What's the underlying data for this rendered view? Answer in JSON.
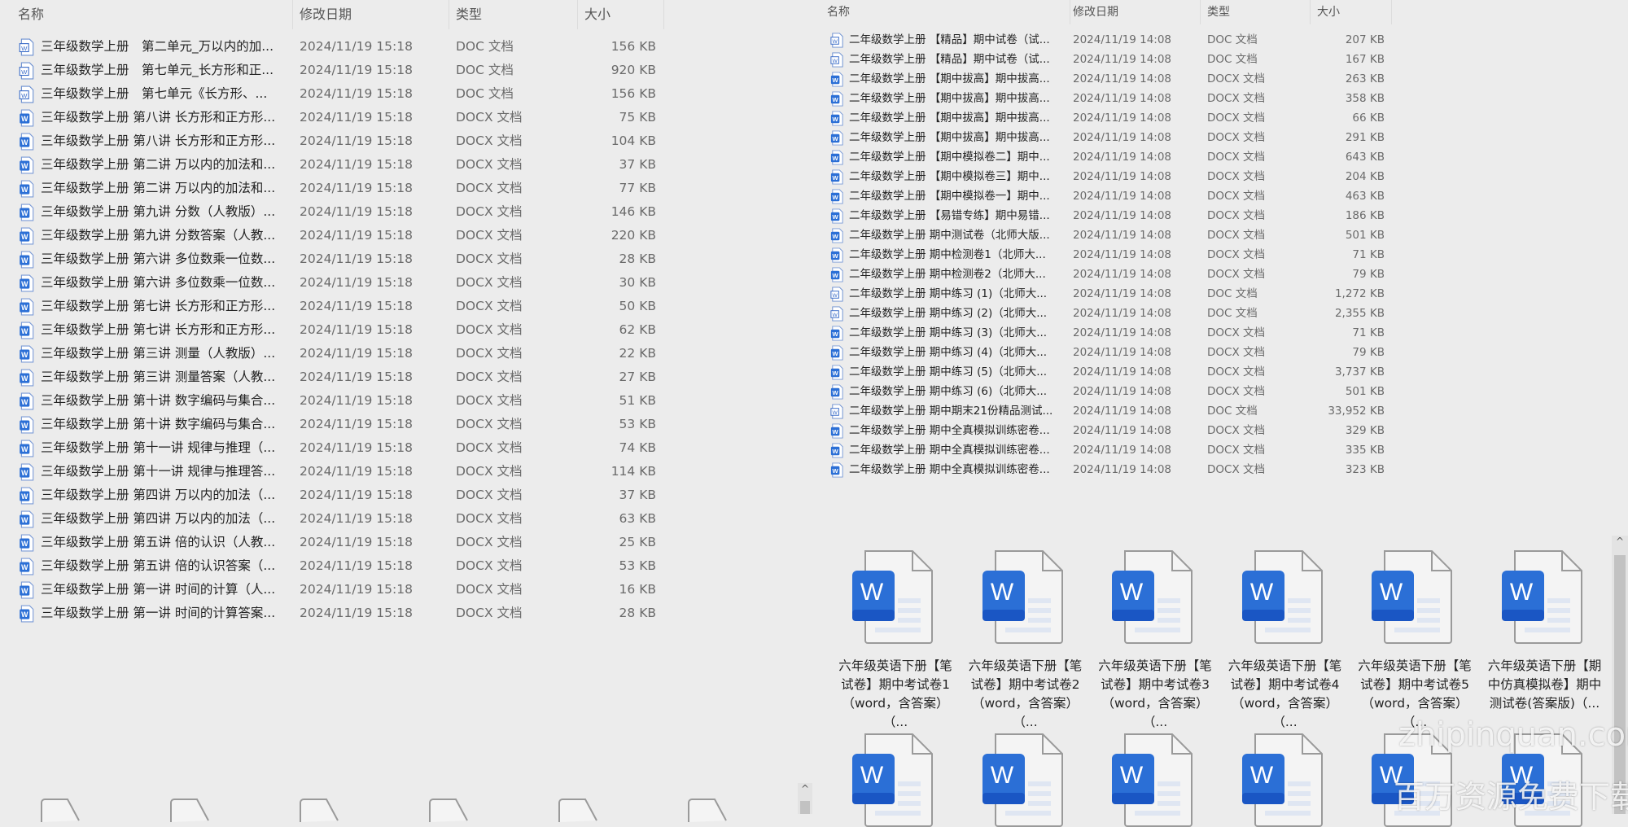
{
  "left_list": {
    "columns": {
      "name": "名称",
      "date": "修改日期",
      "type": "类型",
      "size": "大小"
    },
    "rows": [
      {
        "icon": "doc",
        "name": "三年级数学上册　第二单元_万以内的加...",
        "date": "2024/11/19 15:18",
        "type": "DOC 文档",
        "size": "156 KB"
      },
      {
        "icon": "doc",
        "name": "三年级数学上册　第七单元_长方形和正...",
        "date": "2024/11/19 15:18",
        "type": "DOC 文档",
        "size": "920 KB"
      },
      {
        "icon": "doc",
        "name": "三年级数学上册　第七单元《长方形、...",
        "date": "2024/11/19 15:18",
        "type": "DOC 文档",
        "size": "156 KB"
      },
      {
        "icon": "docx",
        "name": "三年级数学上册 第八讲 长方形和正方形...",
        "date": "2024/11/19 15:18",
        "type": "DOCX 文档",
        "size": "75 KB"
      },
      {
        "icon": "docx",
        "name": "三年级数学上册 第八讲 长方形和正方形...",
        "date": "2024/11/19 15:18",
        "type": "DOCX 文档",
        "size": "104 KB"
      },
      {
        "icon": "docx",
        "name": "三年级数学上册 第二讲 万以内的加法和...",
        "date": "2024/11/19 15:18",
        "type": "DOCX 文档",
        "size": "37 KB"
      },
      {
        "icon": "docx",
        "name": "三年级数学上册 第二讲 万以内的加法和...",
        "date": "2024/11/19 15:18",
        "type": "DOCX 文档",
        "size": "77 KB"
      },
      {
        "icon": "docx",
        "name": "三年级数学上册 第九讲 分数（人教版）...",
        "date": "2024/11/19 15:18",
        "type": "DOCX 文档",
        "size": "146 KB"
      },
      {
        "icon": "docx",
        "name": "三年级数学上册 第九讲 分数答案（人教...",
        "date": "2024/11/19 15:18",
        "type": "DOCX 文档",
        "size": "220 KB"
      },
      {
        "icon": "docx",
        "name": "三年级数学上册 第六讲 多位数乘一位数...",
        "date": "2024/11/19 15:18",
        "type": "DOCX 文档",
        "size": "28 KB"
      },
      {
        "icon": "docx",
        "name": "三年级数学上册 第六讲 多位数乘一位数...",
        "date": "2024/11/19 15:18",
        "type": "DOCX 文档",
        "size": "30 KB"
      },
      {
        "icon": "docx",
        "name": "三年级数学上册 第七讲 长方形和正方形...",
        "date": "2024/11/19 15:18",
        "type": "DOCX 文档",
        "size": "50 KB"
      },
      {
        "icon": "docx",
        "name": "三年级数学上册 第七讲 长方形和正方形...",
        "date": "2024/11/19 15:18",
        "type": "DOCX 文档",
        "size": "62 KB"
      },
      {
        "icon": "docx",
        "name": "三年级数学上册 第三讲 测量（人教版）...",
        "date": "2024/11/19 15:18",
        "type": "DOCX 文档",
        "size": "22 KB"
      },
      {
        "icon": "docx",
        "name": "三年级数学上册 第三讲 测量答案（人教...",
        "date": "2024/11/19 15:18",
        "type": "DOCX 文档",
        "size": "27 KB"
      },
      {
        "icon": "docx",
        "name": "三年级数学上册 第十讲 数字编码与集合...",
        "date": "2024/11/19 15:18",
        "type": "DOCX 文档",
        "size": "51 KB"
      },
      {
        "icon": "docx",
        "name": "三年级数学上册 第十讲 数字编码与集合...",
        "date": "2024/11/19 15:18",
        "type": "DOCX 文档",
        "size": "53 KB"
      },
      {
        "icon": "docx",
        "name": "三年级数学上册 第十一讲 规律与推理（...",
        "date": "2024/11/19 15:18",
        "type": "DOCX 文档",
        "size": "74 KB"
      },
      {
        "icon": "docx",
        "name": "三年级数学上册 第十一讲 规律与推理答...",
        "date": "2024/11/19 15:18",
        "type": "DOCX 文档",
        "size": "114 KB"
      },
      {
        "icon": "docx",
        "name": "三年级数学上册 第四讲 万以内的加法（...",
        "date": "2024/11/19 15:18",
        "type": "DOCX 文档",
        "size": "37 KB"
      },
      {
        "icon": "docx",
        "name": "三年级数学上册 第四讲 万以内的加法（...",
        "date": "2024/11/19 15:18",
        "type": "DOCX 文档",
        "size": "63 KB"
      },
      {
        "icon": "docx",
        "name": "三年级数学上册 第五讲 倍的认识（人教...",
        "date": "2024/11/19 15:18",
        "type": "DOCX 文档",
        "size": "25 KB"
      },
      {
        "icon": "docx",
        "name": "三年级数学上册 第五讲 倍的认识答案（...",
        "date": "2024/11/19 15:18",
        "type": "DOCX 文档",
        "size": "53 KB"
      },
      {
        "icon": "docx",
        "name": "三年级数学上册 第一讲 时间的计算（人...",
        "date": "2024/11/19 15:18",
        "type": "DOCX 文档",
        "size": "16 KB"
      },
      {
        "icon": "docx",
        "name": "三年级数学上册 第一讲 时间的计算答案...",
        "date": "2024/11/19 15:18",
        "type": "DOCX 文档",
        "size": "28 KB"
      }
    ]
  },
  "right_list": {
    "columns": {
      "name": "名称",
      "date": "修改日期",
      "type": "类型",
      "size": "大小"
    },
    "rows": [
      {
        "icon": "doc",
        "name": "二年级数学上册 【精品】期中试卷（试...",
        "date": "2024/11/19 14:08",
        "type": "DOC 文档",
        "size": "207 KB"
      },
      {
        "icon": "doc",
        "name": "二年级数学上册 【精品】期中试卷（试...",
        "date": "2024/11/19 14:08",
        "type": "DOC 文档",
        "size": "167 KB"
      },
      {
        "icon": "docx",
        "name": "二年级数学上册 【期中拔高】期中拔高...",
        "date": "2024/11/19 14:08",
        "type": "DOCX 文档",
        "size": "263 KB"
      },
      {
        "icon": "docx",
        "name": "二年级数学上册 【期中拔高】期中拔高...",
        "date": "2024/11/19 14:08",
        "type": "DOCX 文档",
        "size": "358 KB"
      },
      {
        "icon": "docx",
        "name": "二年级数学上册 【期中拔高】期中拔高...",
        "date": "2024/11/19 14:08",
        "type": "DOCX 文档",
        "size": "66 KB"
      },
      {
        "icon": "docx",
        "name": "二年级数学上册 【期中拔高】期中拔高...",
        "date": "2024/11/19 14:08",
        "type": "DOCX 文档",
        "size": "291 KB"
      },
      {
        "icon": "docx",
        "name": "二年级数学上册 【期中模拟卷二】期中...",
        "date": "2024/11/19 14:08",
        "type": "DOCX 文档",
        "size": "643 KB"
      },
      {
        "icon": "docx",
        "name": "二年级数学上册 【期中模拟卷三】期中...",
        "date": "2024/11/19 14:08",
        "type": "DOCX 文档",
        "size": "204 KB"
      },
      {
        "icon": "docx",
        "name": "二年级数学上册 【期中模拟卷一】期中...",
        "date": "2024/11/19 14:08",
        "type": "DOCX 文档",
        "size": "463 KB"
      },
      {
        "icon": "docx",
        "name": "二年级数学上册 【易错专练】期中易错...",
        "date": "2024/11/19 14:08",
        "type": "DOCX 文档",
        "size": "186 KB"
      },
      {
        "icon": "docx",
        "name": "二年级数学上册 期中测试卷（北师大版...",
        "date": "2024/11/19 14:08",
        "type": "DOCX 文档",
        "size": "501 KB"
      },
      {
        "icon": "docx",
        "name": "二年级数学上册 期中检测卷1（北师大...",
        "date": "2024/11/19 14:08",
        "type": "DOCX 文档",
        "size": "71 KB"
      },
      {
        "icon": "docx",
        "name": "二年级数学上册 期中检测卷2（北师大...",
        "date": "2024/11/19 14:08",
        "type": "DOCX 文档",
        "size": "79 KB"
      },
      {
        "icon": "doc",
        "name": "二年级数学上册 期中练习 (1)（北师大...",
        "date": "2024/11/19 14:08",
        "type": "DOC 文档",
        "size": "1,272 KB"
      },
      {
        "icon": "doc",
        "name": "二年级数学上册 期中练习 (2)（北师大...",
        "date": "2024/11/19 14:08",
        "type": "DOC 文档",
        "size": "2,355 KB"
      },
      {
        "icon": "docx",
        "name": "二年级数学上册 期中练习 (3)（北师大...",
        "date": "2024/11/19 14:08",
        "type": "DOCX 文档",
        "size": "71 KB"
      },
      {
        "icon": "docx",
        "name": "二年级数学上册 期中练习 (4)（北师大...",
        "date": "2024/11/19 14:08",
        "type": "DOCX 文档",
        "size": "79 KB"
      },
      {
        "icon": "docx",
        "name": "二年级数学上册 期中练习 (5)（北师大...",
        "date": "2024/11/19 14:08",
        "type": "DOCX 文档",
        "size": "3,737 KB"
      },
      {
        "icon": "docx",
        "name": "二年级数学上册 期中练习 (6)（北师大...",
        "date": "2024/11/19 14:08",
        "type": "DOCX 文档",
        "size": "501 KB"
      },
      {
        "icon": "doc",
        "name": "二年级数学上册 期中期末21份精品测试...",
        "date": "2024/11/19 14:08",
        "type": "DOC 文档",
        "size": "33,952 KB"
      },
      {
        "icon": "docx",
        "name": "二年级数学上册 期中全真模拟训练密卷...",
        "date": "2024/11/19 14:08",
        "type": "DOCX 文档",
        "size": "329 KB"
      },
      {
        "icon": "docx",
        "name": "二年级数学上册 期中全真模拟训练密卷...",
        "date": "2024/11/19 14:08",
        "type": "DOCX 文档",
        "size": "335 KB"
      },
      {
        "icon": "docx",
        "name": "二年级数学上册 期中全真模拟训练密卷...",
        "date": "2024/11/19 14:08",
        "type": "DOCX 文档",
        "size": "323 KB"
      }
    ]
  },
  "icon_grid": {
    "tiles": [
      {
        "label": "六年级英语下册【笔试卷】期中考试卷1（word，含答案）（..."
      },
      {
        "label": "六年级英语下册【笔试卷】期中考试卷2（word，含答案）（..."
      },
      {
        "label": "六年级英语下册【笔试卷】期中考试卷3（word，含答案）（..."
      },
      {
        "label": "六年级英语下册【笔试卷】期中考试卷4（word，含答案）（..."
      },
      {
        "label": "六年级英语下册【笔试卷】期中考试卷5（word，含答案）（..."
      },
      {
        "label": "六年级英语下册【期中仿真模拟卷】期中测试卷(答案版)（..."
      }
    ],
    "second_row_count": 6
  },
  "watermark": {
    "line1": "zhipinquan.com",
    "line2": "百万资源免费下载"
  },
  "colors": {
    "word_blue": "#2b6fd6",
    "word_dark": "#1a56c4",
    "bg": "#ececec"
  }
}
